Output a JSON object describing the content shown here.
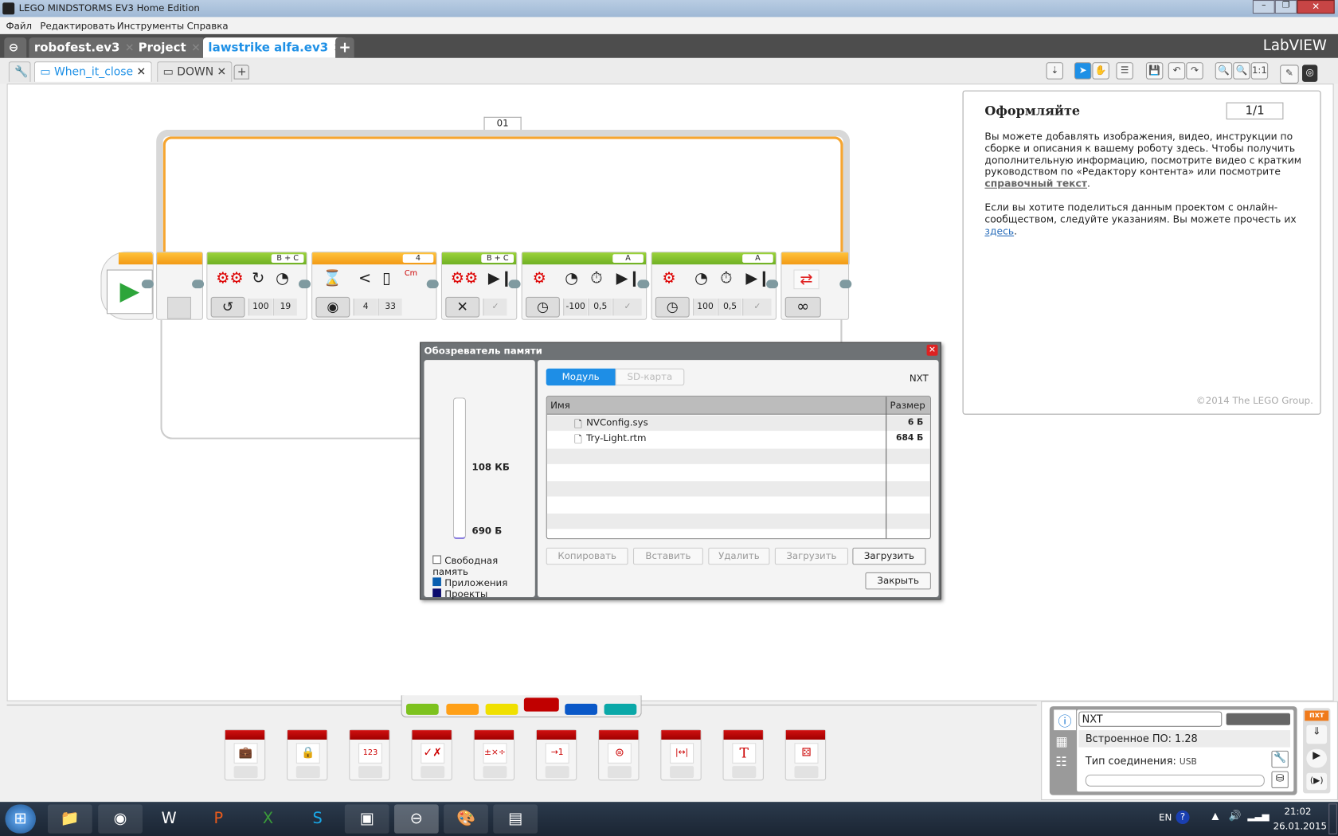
{
  "window": {
    "title": "LEGO MINDSTORMS EV3 Home Edition"
  },
  "menu": [
    "Файл",
    "Редактировать",
    "Инструменты",
    "Справка"
  ],
  "project_tabs": [
    {
      "label": "robofest.ev3"
    },
    {
      "label": "Project"
    },
    {
      "label": "lawstrike alfa.ev3",
      "active": true
    }
  ],
  "program_tabs": [
    {
      "label": "When_it_close",
      "active": true
    },
    {
      "label": "DOWN"
    }
  ],
  "brand": "LabVIEW",
  "toolbar": {
    "zoom_reset": "1:1"
  },
  "program": {
    "loop_label": "01",
    "blocks": [
      {
        "type": "move-steering",
        "port": "B + C",
        "params": [
          "100",
          "19"
        ]
      },
      {
        "type": "wait-ultrasonic",
        "port": "4",
        "params": [
          "4",
          "33"
        ],
        "unit": "Cm"
      },
      {
        "type": "move-steering-off",
        "port": "B + C"
      },
      {
        "type": "medium-motor",
        "port": "A",
        "params": [
          "-100",
          "0,5"
        ]
      },
      {
        "type": "medium-motor",
        "port": "A",
        "params": [
          "100",
          "0,5"
        ]
      },
      {
        "type": "loop-end",
        "mode": "∞"
      }
    ]
  },
  "content_editor": {
    "title": "Оформляйте",
    "page": "1/1",
    "para1": "Вы можете добавлять изображения, видео, инструкции по сборке и описания к вашему роботу здесь. Чтобы получить дополнительную информацию, посмотрите видео с кратким руководством по «Редактору контента» или посмотрите ",
    "para1_link": "справочный текст",
    "para2": "Если вы хотите поделиться данным проектом с онлайн-сообществом, следуйте указаниям. Вы можете прочесть их ",
    "para2_link": "здесь",
    "copyright": "©2014 The LEGO Group."
  },
  "memory_dialog": {
    "title": "Обозреватель памяти",
    "tabs": [
      "Модуль",
      "SD-карта"
    ],
    "device": "NXT",
    "columns": [
      "Имя",
      "Размер"
    ],
    "files": [
      {
        "name": "NVConfig.sys",
        "size": "6 Б"
      },
      {
        "name": "Try-Light.rtm",
        "size": "684 Б"
      }
    ],
    "free": "108 КБ",
    "used": "690 Б",
    "legend": [
      {
        "label": "Свободная память",
        "color": "#ffffff"
      },
      {
        "label": "Приложения",
        "color": "#0a5fb0"
      },
      {
        "label": "Проекты",
        "color": "#0b0b6e"
      }
    ],
    "buttons": [
      "Копировать",
      "Вставить",
      "Удалить",
      "Загрузить",
      "Загрузить"
    ],
    "close": "Закрыть"
  },
  "palette": {
    "categories": [
      "#7dc21e",
      "#ffa018",
      "#f0e000",
      "#c00000",
      "#0a58c8",
      "#0aa8a8"
    ]
  },
  "hardware": {
    "name": "NXT",
    "firmware": "Встроенное ПО: 1.28",
    "connection_label": "Тип соединения:",
    "connection": "USB",
    "badge": "пхт"
  },
  "taskbar": {
    "lang": "EN",
    "time": "21:02",
    "date": "26.01.2015"
  }
}
